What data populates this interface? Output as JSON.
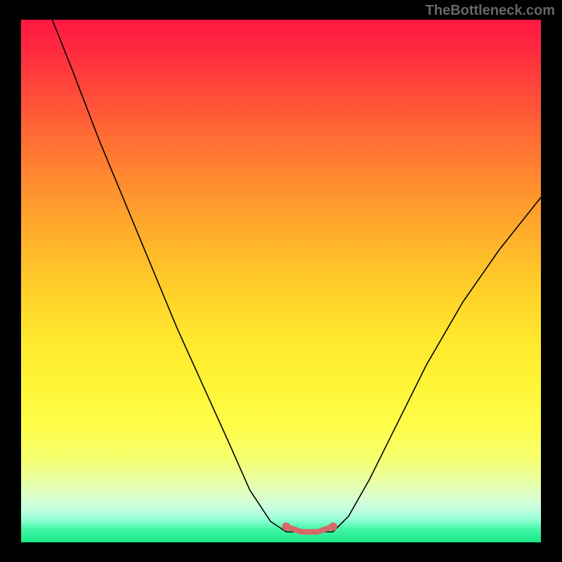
{
  "watermark": "TheBottleneck.com",
  "chart_data": {
    "type": "line",
    "title": "",
    "xlabel": "",
    "ylabel": "",
    "xlim": [
      0,
      100
    ],
    "ylim": [
      0,
      100
    ],
    "curve_points": [
      {
        "x": 6,
        "y": 100
      },
      {
        "x": 10,
        "y": 90
      },
      {
        "x": 15,
        "y": 77
      },
      {
        "x": 20,
        "y": 65
      },
      {
        "x": 25,
        "y": 53
      },
      {
        "x": 30,
        "y": 41
      },
      {
        "x": 35,
        "y": 30
      },
      {
        "x": 40,
        "y": 19
      },
      {
        "x": 44,
        "y": 10
      },
      {
        "x": 48,
        "y": 4
      },
      {
        "x": 51,
        "y": 2
      },
      {
        "x": 54,
        "y": 2
      },
      {
        "x": 57,
        "y": 2
      },
      {
        "x": 60,
        "y": 2
      },
      {
        "x": 63,
        "y": 5
      },
      {
        "x": 67,
        "y": 12
      },
      {
        "x": 72,
        "y": 22
      },
      {
        "x": 78,
        "y": 34
      },
      {
        "x": 85,
        "y": 46
      },
      {
        "x": 92,
        "y": 56
      },
      {
        "x": 100,
        "y": 66
      }
    ],
    "accent_segment": [
      {
        "x": 51,
        "y": 3
      },
      {
        "x": 54,
        "y": 2
      },
      {
        "x": 57,
        "y": 2
      },
      {
        "x": 60,
        "y": 3
      }
    ],
    "gradient_colors": {
      "top": "#ff1842",
      "mid_upper": "#ff8830",
      "mid": "#ffd62a",
      "mid_lower": "#f6ff6e",
      "bottom": "#19e786"
    }
  }
}
